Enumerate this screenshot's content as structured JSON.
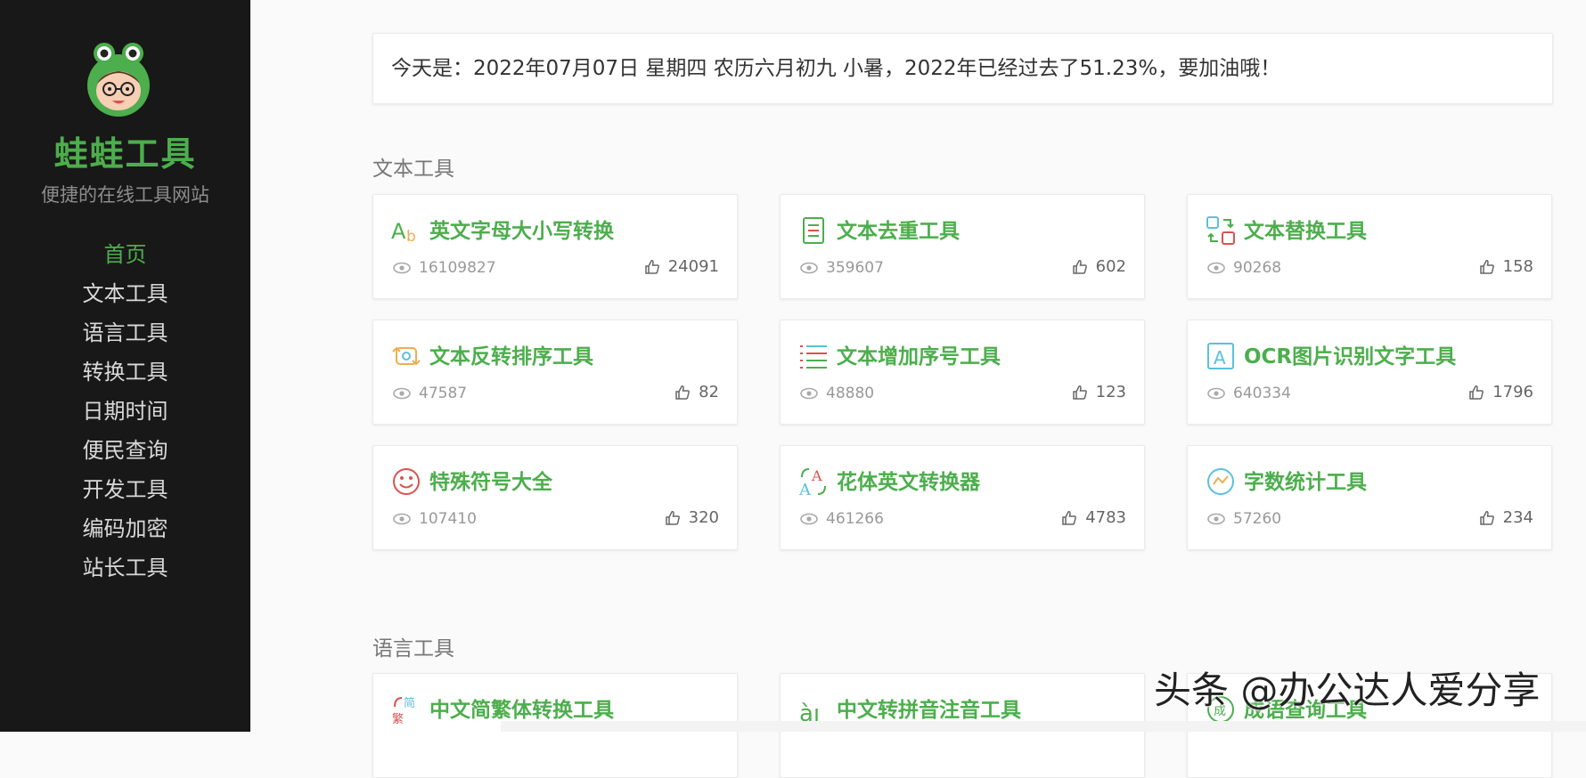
{
  "brand": {
    "title": "蛙蛙工具",
    "subtitle": "便捷的在线工具网站"
  },
  "nav": [
    {
      "label": "首页",
      "active": true
    },
    {
      "label": "文本工具"
    },
    {
      "label": "语言工具"
    },
    {
      "label": "转换工具"
    },
    {
      "label": "日期时间"
    },
    {
      "label": "便民查询"
    },
    {
      "label": "开发工具"
    },
    {
      "label": "编码加密"
    },
    {
      "label": "站长工具"
    }
  ],
  "date_banner": "今天是：2022年07月07日 星期四 农历六月初九 小暑，2022年已经过去了51.23%，要加油哦！",
  "sections": [
    {
      "title": "文本工具",
      "cards": [
        {
          "title": "英文字母大小写转换",
          "views": "16109827",
          "likes": "24091",
          "icon": "text-case-icon"
        },
        {
          "title": "文本去重工具",
          "views": "359607",
          "likes": "602",
          "icon": "document-icon"
        },
        {
          "title": "文本替换工具",
          "views": "90268",
          "likes": "158",
          "icon": "replace-icon"
        },
        {
          "title": "文本反转排序工具",
          "views": "47587",
          "likes": "82",
          "icon": "reverse-icon"
        },
        {
          "title": "文本增加序号工具",
          "views": "48880",
          "likes": "123",
          "icon": "numbered-list-icon"
        },
        {
          "title": "OCR图片识别文字工具",
          "views": "640334",
          "likes": "1796",
          "icon": "ocr-icon"
        },
        {
          "title": "特殊符号大全",
          "views": "107410",
          "likes": "320",
          "icon": "smiley-icon"
        },
        {
          "title": "花体英文转换器",
          "views": "461266",
          "likes": "4783",
          "icon": "fancy-font-icon"
        },
        {
          "title": "字数统计工具",
          "views": "57260",
          "likes": "234",
          "icon": "stats-icon"
        }
      ]
    },
    {
      "title": "语言工具",
      "cards": [
        {
          "title": "中文简繁体转换工具",
          "icon": "simplified-traditional-icon"
        },
        {
          "title": "中文转拼音注音工具",
          "icon": "pinyin-icon"
        },
        {
          "title": "成语查询工具",
          "icon": "idiom-icon"
        }
      ]
    }
  ],
  "watermark": "头条 @办公达人爱分享"
}
